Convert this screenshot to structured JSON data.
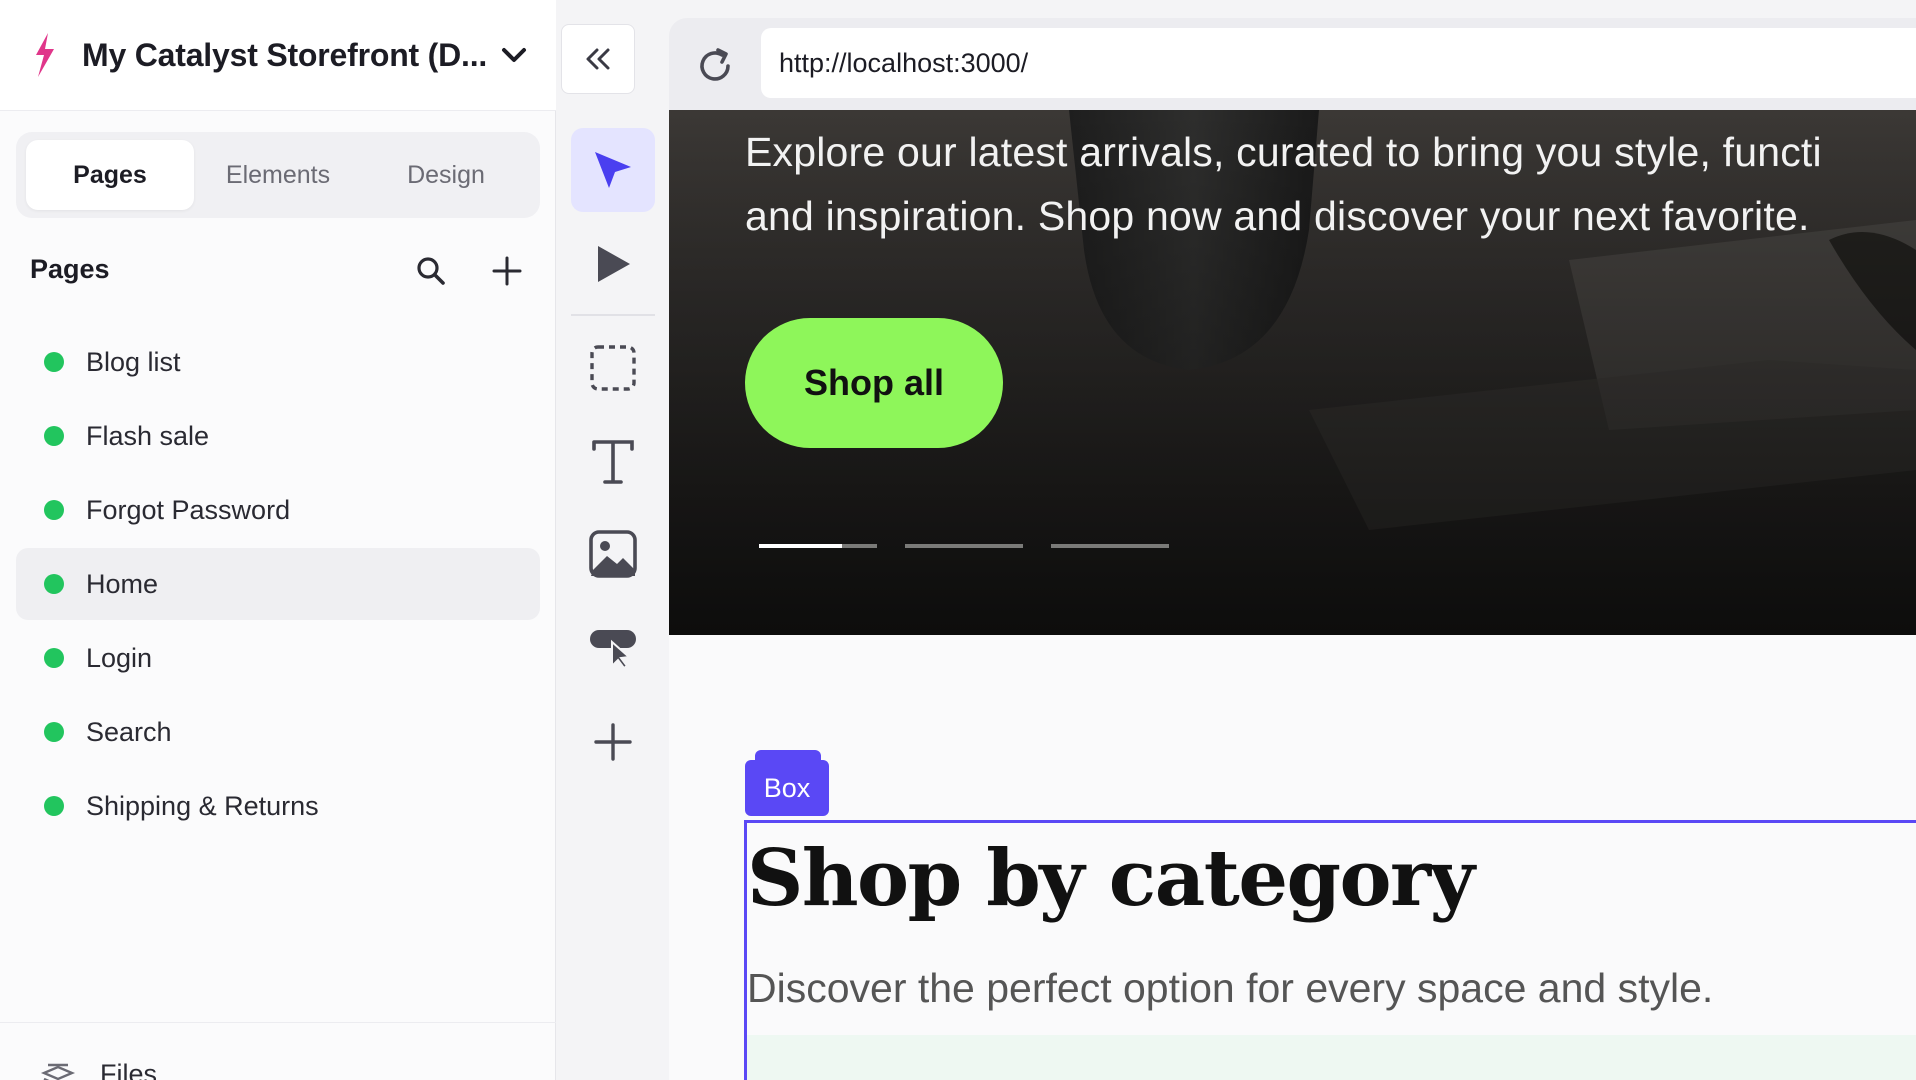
{
  "sidebar": {
    "project_name": "My Catalyst Storefront (D...",
    "tabs": [
      {
        "label": "Pages",
        "active": true
      },
      {
        "label": "Elements",
        "active": false
      },
      {
        "label": "Design",
        "active": false
      }
    ],
    "pages_title": "Pages",
    "pages": [
      {
        "label": "Blog list",
        "selected": false
      },
      {
        "label": "Flash sale",
        "selected": false
      },
      {
        "label": "Forgot Password",
        "selected": false
      },
      {
        "label": "Home",
        "selected": true
      },
      {
        "label": "Login",
        "selected": false
      },
      {
        "label": "Search",
        "selected": false
      },
      {
        "label": "Shipping & Returns",
        "selected": false
      }
    ],
    "footer_label": "Files"
  },
  "toolbar": {
    "tools": [
      "select-cursor-icon",
      "preview-play-icon",
      "box-select-icon",
      "text-icon",
      "image-icon",
      "component-icon",
      "add-icon"
    ],
    "active_tool": "select-cursor-icon"
  },
  "browser": {
    "url": "http://localhost:3000/"
  },
  "preview": {
    "hero_text": "Explore our latest arrivals, curated to bring you style, functi\nand inspiration. Shop now and discover your next favorite.",
    "shop_button": "Shop all",
    "slide_indicators": [
      0.7,
      0,
      0
    ],
    "box_tag": "Box",
    "section_title": "Shop by category",
    "section_subtitle": "Discover the perfect option for every space and style."
  },
  "colors": {
    "accent": "#5a48f5",
    "status_dot": "#22c55e",
    "logo": "#e0368a",
    "cta": "#8ef65a"
  }
}
